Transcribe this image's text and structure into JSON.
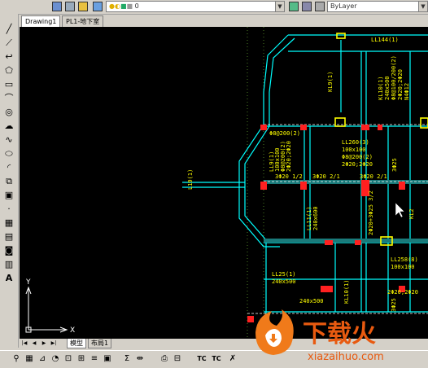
{
  "top_toolbar": {
    "layer_value": "0",
    "linetype_value": "ByLayer"
  },
  "tabs": [
    {
      "label": "Drawing1"
    },
    {
      "label": "PL1-地下室"
    }
  ],
  "layout_tabs": [
    {
      "label": "模型"
    },
    {
      "label": "布局1"
    }
  ],
  "left_tools": [
    "line-tool",
    "polyline-tool",
    "arc-tool",
    "polygon-tool",
    "rectangle-tool",
    "arc2-tool",
    "circle-tool",
    "revcloud-tool",
    "spline-tool",
    "ellipse-tool",
    "ellipse-arc-tool",
    "insert-tool",
    "block-tool",
    "point-tool",
    "hatch-tool",
    "gradient-tool",
    "region-tool",
    "table-tool",
    "text-tool"
  ],
  "drawing": {
    "labels": [
      {
        "text": "LL144(1)",
        "color": "#ffff00"
      },
      {
        "text": "KL9(1)",
        "color": "#ffff00"
      },
      {
        "text": "KL10(1)",
        "color": "#ffff00"
      },
      {
        "text": "240x500",
        "color": "#ffff00"
      },
      {
        "text": "Φ8@100/200(2)",
        "color": "#ffff00"
      },
      {
        "text": "2Φ20;2Φ20",
        "color": "#ffff00"
      },
      {
        "text": "N4Φ12",
        "color": "#ffff00"
      },
      {
        "text": "Φ8@200(2)",
        "color": "#ffff00"
      },
      {
        "text": "LL9(1)",
        "color": "#ffff00"
      },
      {
        "text": "100x100",
        "color": "#ffff00"
      },
      {
        "text": "Φ8@200(2)",
        "color": "#ffff00"
      },
      {
        "text": "2Φ20;2Φ20",
        "color": "#ffff00"
      },
      {
        "text": "LL260(3)",
        "color": "#ffff00"
      },
      {
        "text": "100x100",
        "color": "#ffff00"
      },
      {
        "text": "Φ8@200(2)",
        "color": "#ffff00"
      },
      {
        "text": "2Φ20;2Φ20",
        "color": "#ffff00"
      },
      {
        "text": "3Φ20 1/2",
        "color": "#ffff00"
      },
      {
        "text": "3Φ20 2/1",
        "color": "#ffff00"
      },
      {
        "text": "3Φ20 2/1",
        "color": "#ffff00"
      },
      {
        "text": "3Φ25",
        "color": "#ffff00"
      },
      {
        "text": "LL11(1)",
        "color": "#ffff00"
      },
      {
        "text": "240x600",
        "color": "#ffff00"
      },
      {
        "text": "L19(1)",
        "color": "#ffff00"
      },
      {
        "text": "2Φ20+3Φ25 3/2",
        "color": "#ffff00"
      },
      {
        "text": "KL2",
        "color": "#ffff00"
      },
      {
        "text": "LL25(1)",
        "color": "#ffff00"
      },
      {
        "text": "240x500",
        "color": "#ffff00"
      },
      {
        "text": "LL258(8)",
        "color": "#ffff00"
      },
      {
        "text": "100x100",
        "color": "#ffff00"
      },
      {
        "text": "2Φ20;2Φ20",
        "color": "#ffff00"
      },
      {
        "text": "240x500",
        "color": "#ffff00"
      },
      {
        "text": "KL10(1)",
        "color": "#ffff00"
      },
      {
        "text": "3Φ25",
        "color": "#ffff00"
      }
    ],
    "ucs": {
      "x_label": "X",
      "y_label": "Y"
    }
  },
  "watermark": {
    "brand": "下载火",
    "url": "xiazaihuo.com"
  },
  "colors": {
    "canvas": "#000000",
    "beam": "#00ffff",
    "wall": "#1a7a7a",
    "text": "#ffff00",
    "column": "#ff2020",
    "hatch_white": "#ffffff",
    "grid": "#7ecf3c",
    "ui": "#d4d0c8"
  }
}
